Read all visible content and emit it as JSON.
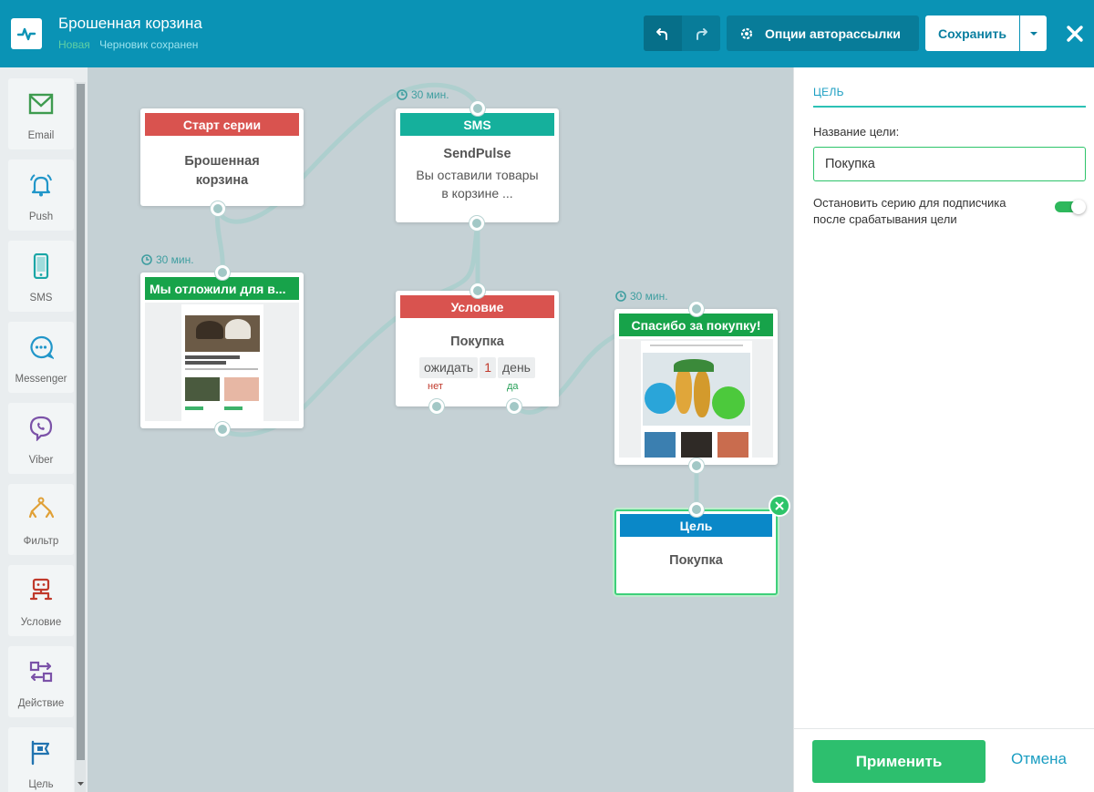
{
  "header": {
    "title": "Брошенная корзина",
    "status_new": "Новая",
    "status_saved": "Черновик сохранен",
    "options_label": "Опции авторассылки",
    "save_label": "Сохранить"
  },
  "tools": [
    {
      "label": "Email",
      "icon": "envelope-icon",
      "color": "#3e9b4f"
    },
    {
      "label": "Push",
      "icon": "bell-icon",
      "color": "#2196c9"
    },
    {
      "label": "SMS",
      "icon": "phone-icon",
      "color": "#1aa6a6"
    },
    {
      "label": "Messenger",
      "icon": "chat-icon",
      "color": "#2196c9"
    },
    {
      "label": "Viber",
      "icon": "viber-icon",
      "color": "#7b52a8"
    },
    {
      "label": "Фильтр",
      "icon": "filter-icon",
      "color": "#e0a036"
    },
    {
      "label": "Условие",
      "icon": "condition-icon",
      "color": "#c0392b"
    },
    {
      "label": "Действие",
      "icon": "action-icon",
      "color": "#7b52a8"
    },
    {
      "label": "Цель",
      "icon": "flag-icon",
      "color": "#2173b0"
    }
  ],
  "nodes": {
    "start": {
      "header": "Старт серии",
      "body": "Брошенная корзина"
    },
    "sms": {
      "timer": "30 мин.",
      "header": "SMS",
      "sender": "SendPulse",
      "text": "Вы оставили товары в корзине ..."
    },
    "email1": {
      "timer": "30 мин.",
      "header": "Мы отложили для в..."
    },
    "condition": {
      "header": "Условие",
      "title": "Покупка",
      "wait_label": "ожидать",
      "wait_value": "1",
      "wait_unit": "день",
      "no_label": "нет",
      "yes_label": "да"
    },
    "email2": {
      "timer": "30 мин.",
      "header": "Спасибо за покупку!"
    },
    "goal": {
      "header": "Цель",
      "body": "Покупка"
    }
  },
  "panel": {
    "title": "ЦЕЛЬ",
    "name_label": "Название цели:",
    "name_value": "Покупка",
    "stop_label": "Остановить серию для подписчика после срабатывания цели",
    "stop_enabled": true,
    "apply_label": "Применить",
    "cancel_label": "Отмена"
  },
  "colors": {
    "header_bg": "#0a93b5",
    "accent_green": "#2dbf6e",
    "node_red": "#d9534f",
    "node_teal": "#15b09c",
    "node_green": "#17a34a",
    "node_blue": "#0a88c8"
  }
}
